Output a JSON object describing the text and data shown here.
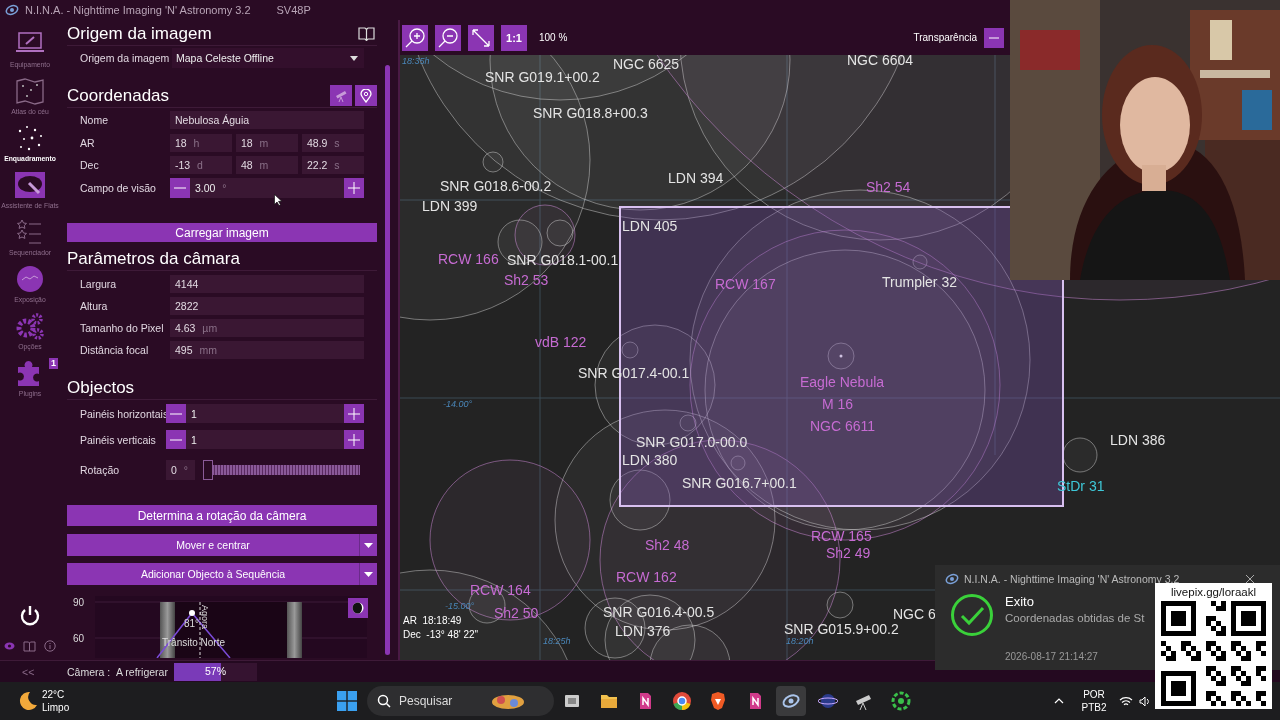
{
  "window": {
    "title": "N.I.N.A. - Nighttime Imaging 'N' Astronomy 3.2",
    "profile": "SV48P"
  },
  "sidebar": {
    "items": [
      {
        "label": "Equipamento",
        "kind": "equipment",
        "selected": false
      },
      {
        "label": "Atlas do céu",
        "kind": "atlas",
        "selected": false
      },
      {
        "label": "Enquadramento",
        "kind": "framing",
        "selected": true
      },
      {
        "label": "Assistente de Flats",
        "kind": "flats",
        "selected": false
      },
      {
        "label": "Sequenciador",
        "kind": "sequencer",
        "selected": false
      },
      {
        "label": "Exposição",
        "kind": "exposure",
        "selected": false
      },
      {
        "label": "Opções",
        "kind": "options",
        "selected": false
      },
      {
        "label": "Plugins",
        "kind": "plugins",
        "selected": false,
        "badge": "1"
      }
    ],
    "collapse": "<<"
  },
  "image_source": {
    "title": "Origem da imagem",
    "label": "Origem da imagem",
    "value": "Mapa Celeste Offline"
  },
  "coordinates": {
    "title": "Coordenadas",
    "name_label": "Nome",
    "name": "Nebulosa Águia",
    "ra_label": "AR",
    "ra": [
      {
        "value": "18",
        "unit": "h"
      },
      {
        "value": "18",
        "unit": "m"
      },
      {
        "value": "48.9",
        "unit": "s"
      }
    ],
    "dec_label": "Dec",
    "dec": [
      {
        "value": "-13",
        "unit": "d"
      },
      {
        "value": "48",
        "unit": "m"
      },
      {
        "value": "22.2",
        "unit": "s"
      }
    ],
    "fov_label": "Campo de visão",
    "fov": "3.00",
    "fov_unit": "°",
    "load_button": "Carregar imagem"
  },
  "camera": {
    "title": "Parâmetros da câmara",
    "rows": [
      {
        "label": "Largura",
        "value": "4144"
      },
      {
        "label": "Altura",
        "value": "2822"
      },
      {
        "label": "Tamanho do Pixel",
        "value": "4.63",
        "unit": "µm"
      },
      {
        "label": "Distância focal",
        "value": "495",
        "unit": "mm"
      }
    ]
  },
  "objects": {
    "title": "Objectos",
    "panels": [
      {
        "label": "Painéis horizontais",
        "value": "1"
      },
      {
        "label": "Painéis verticais",
        "value": "1"
      }
    ],
    "rotation_label": "Rotação",
    "rotation": "0",
    "rotation_unit": "°",
    "rotation_slider": {
      "level": 0
    }
  },
  "actions": [
    {
      "label": "Determina a rotação da câmera",
      "kind": "plain"
    },
    {
      "label": "Mover e centrar",
      "kind": "split"
    },
    {
      "label": "Adicionar Objecto à Sequência",
      "kind": "split"
    }
  ],
  "altitude_chart": {
    "yticks": [
      "90",
      "60"
    ],
    "peak": "81°",
    "transit": "Trânsito Norte",
    "now": "Agora"
  },
  "status_bar": {
    "device": "Câmera :",
    "state": "A refrigerar",
    "progress": {
      "level": 0.57,
      "reading": "57%"
    }
  },
  "map": {
    "toolbar": {
      "zoom": "1:1",
      "scale": "100 %",
      "transparency_label": "Transparência"
    },
    "labels": [
      {
        "text": "SNR G019.1+00.2",
        "color": "#e4e4e4"
      },
      {
        "text": "NGC 6625",
        "color": "#e4e4e4"
      },
      {
        "text": "NGC 6604",
        "color": "#e4e4e4"
      },
      {
        "text": "SNR G018.8+00.3",
        "color": "#e4e4e4"
      },
      {
        "text": "SNR G018.6-00.2",
        "color": "#e4e4e4"
      },
      {
        "text": "LDN 394",
        "color": "#e4e4e4"
      },
      {
        "text": "Sh2 54",
        "color": "#c66bd2"
      },
      {
        "text": "LDN 399",
        "color": "#e4e4e4"
      },
      {
        "text": "LDN 405",
        "color": "#e4e4e4"
      },
      {
        "text": "RCW 166",
        "color": "#c66bd2"
      },
      {
        "text": "SNR G018.1-00.1",
        "color": "#e4e4e4"
      },
      {
        "text": "Sh2 53",
        "color": "#c66bd2"
      },
      {
        "text": "RCW 167",
        "color": "#c66bd2"
      },
      {
        "text": "Trumpler 32",
        "color": "#e4e4e4"
      },
      {
        "text": "vdB 122",
        "color": "#c66bd2"
      },
      {
        "text": "SNR G017.4-00.1",
        "color": "#e4e4e4"
      },
      {
        "text": "Eagle Nebula",
        "color": "#c66bd2"
      },
      {
        "text": "M 16",
        "color": "#c66bd2"
      },
      {
        "text": "NGC 6611",
        "color": "#c66bd2"
      },
      {
        "text": "LDN 386",
        "color": "#e4e4e4"
      },
      {
        "text": "SNR G017.0-00.0",
        "color": "#e4e4e4"
      },
      {
        "text": "LDN 380",
        "color": "#e4e4e4"
      },
      {
        "text": "SNR G016.7+00.1",
        "color": "#e4e4e4"
      },
      {
        "text": "StDr 31",
        "color": "#3ec8d8"
      },
      {
        "text": "RCW 165",
        "color": "#c66bd2"
      },
      {
        "text": "Sh2 48",
        "color": "#c66bd2"
      },
      {
        "text": "Sh2 49",
        "color": "#c66bd2"
      },
      {
        "text": "RCW 162",
        "color": "#c66bd2"
      },
      {
        "text": "RCW 164",
        "color": "#c66bd2"
      },
      {
        "text": "Sh2 50",
        "color": "#c66bd2"
      },
      {
        "text": "SNR G016.4-00.5",
        "color": "#e4e4e4"
      },
      {
        "text": "LDN 376",
        "color": "#e4e4e4"
      },
      {
        "text": "NGC 6",
        "color": "#e4e4e4"
      },
      {
        "text": "SNR G015.9+00.2",
        "color": "#e4e4e4"
      }
    ],
    "grid_labels": [
      "18:35h",
      "-14.00°",
      "-15.00°",
      "18:25h",
      "18:20h"
    ],
    "cursor": {
      "ra": "AR  18:18:49",
      "dec": "Dec  -13° 48' 22\""
    }
  },
  "notification": {
    "app": "N.I.N.A. - Nighttime Imaging 'N' Astronomy 3.2",
    "title": "Exito",
    "message": "Coordenadas obtidas de St",
    "time": "2026-08-17 21:14:27"
  },
  "overlay": {
    "link": "livepix.gg/loraakl"
  },
  "taskbar": {
    "temperature": "22°C",
    "weather": "Limpo",
    "search_placeholder": "Pesquisar",
    "language": "POR",
    "layout": "PTB2"
  }
}
